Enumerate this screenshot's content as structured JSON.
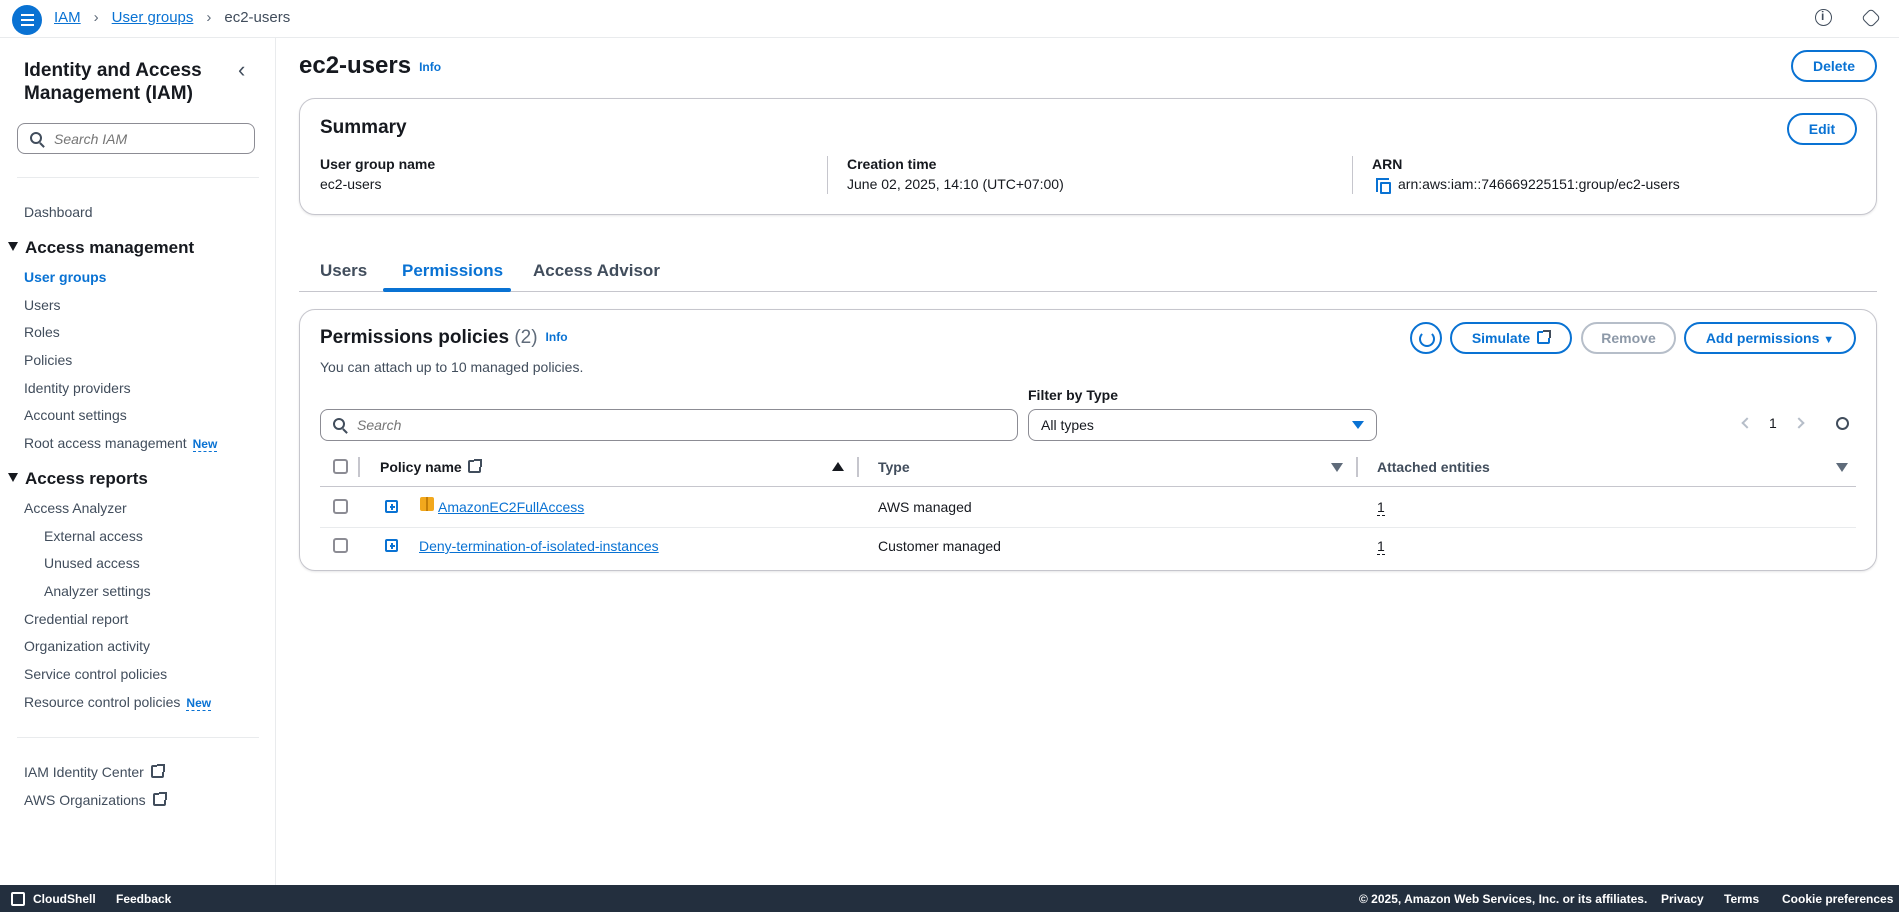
{
  "breadcrumb": [
    "IAM",
    "User groups",
    "ec2-users"
  ],
  "sidebar": {
    "title": "Identity and Access Management (IAM)",
    "search_placeholder": "Search IAM",
    "dashboard": "Dashboard",
    "access_management": {
      "label": "Access management",
      "items": [
        "User groups",
        "Users",
        "Roles",
        "Policies",
        "Identity providers",
        "Account settings",
        "Root access management"
      ]
    },
    "access_reports": {
      "label": "Access reports",
      "items": [
        "Access Analyzer",
        "External access",
        "Unused access",
        "Analyzer settings",
        "Credential report",
        "Organization activity",
        "Service control policies",
        "Resource control policies"
      ]
    },
    "new_badge": "New",
    "external_links": [
      "IAM Identity Center",
      "AWS Organizations"
    ]
  },
  "page": {
    "title": "ec2-users",
    "info": "Info",
    "delete_label": "Delete"
  },
  "summary": {
    "title": "Summary",
    "edit_label": "Edit",
    "fields": [
      {
        "label": "User group name",
        "value": "ec2-users"
      },
      {
        "label": "Creation time",
        "value": "June 02, 2025, 14:10 (UTC+07:00)"
      },
      {
        "label": "ARN",
        "value": "arn:aws:iam::746669225151:group/ec2-users"
      }
    ]
  },
  "tabs": [
    "Users",
    "Permissions",
    "Access Advisor"
  ],
  "permissions": {
    "title": "Permissions policies",
    "count": "(2)",
    "info": "Info",
    "description": "You can attach up to 10 managed policies.",
    "simulate_label": "Simulate",
    "remove_label": "Remove",
    "add_label": "Add permissions",
    "search_placeholder": "Search",
    "filter_label": "Filter by Type",
    "filter_value": "All types",
    "page_number": "1",
    "columns": [
      "Policy name",
      "Type",
      "Attached entities"
    ],
    "rows": [
      {
        "name": "AmazonEC2FullAccess",
        "type": "AWS managed",
        "entities": "1"
      },
      {
        "name": "Deny-termination-of-isolated-instances",
        "type": "Customer managed",
        "entities": "1"
      }
    ]
  },
  "footer": {
    "cloudshell": "CloudShell",
    "feedback": "Feedback",
    "copyright": "© 2025, Amazon Web Services, Inc. or its affiliates.",
    "privacy": "Privacy",
    "terms": "Terms",
    "cookies": "Cookie preferences"
  },
  "colors": {
    "accent": "#0972d3",
    "footer_bg": "#232f3e",
    "aws_icon": "#f2a81d"
  }
}
